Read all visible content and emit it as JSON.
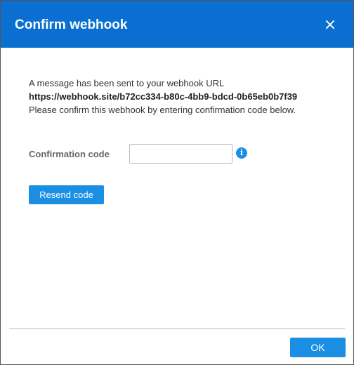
{
  "dialog": {
    "title": "Confirm webhook",
    "close_label": "×",
    "message_line1": "A message has been sent to your webhook URL",
    "webhook_url": "https://webhook.site/b72cc334-b80c-4bb9-bdcd-0b65eb0b7f39",
    "message_line3": "Please confirm this webhook by entering confirmation code below.",
    "field_label": "Confirmation code",
    "code_value": "",
    "code_placeholder": "",
    "info_glyph": "i",
    "resend_label": "Resend code",
    "ok_label": "OK"
  },
  "colors": {
    "header": "#0a6fd1",
    "button": "#1a8fe3",
    "info_icon": "#1a8fe3"
  },
  "icons": {
    "close": "close-icon",
    "info": "info-icon"
  }
}
